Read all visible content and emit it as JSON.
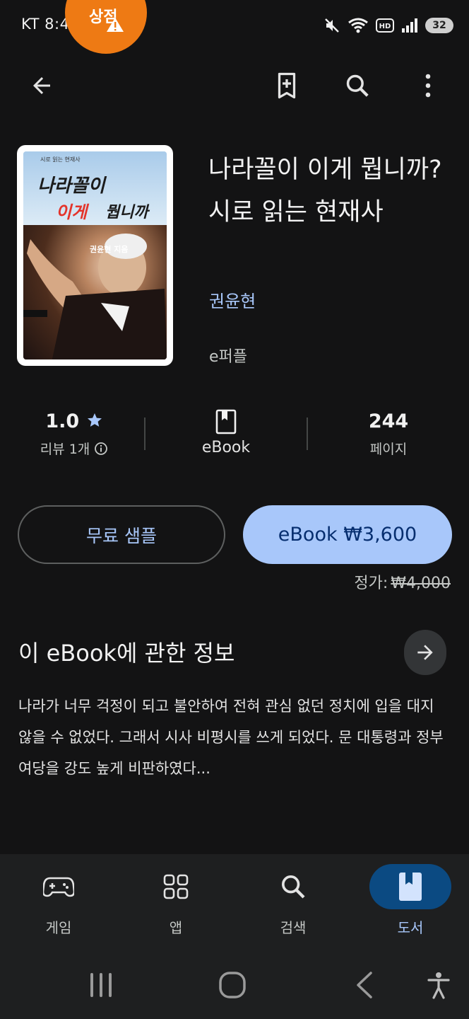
{
  "status_bar": {
    "carrier_time": "KT 8:48",
    "promo_badge": "상점",
    "battery": "32"
  },
  "book": {
    "title": "나라꼴이 이게 뭡니까? 시로 읽는 현재사",
    "author": "권윤현",
    "publisher": "e퍼플",
    "cover": {
      "series": "시로 읽는 현재사",
      "title_line1": "나라꼴이",
      "title_line2_red": "이게",
      "title_line2_black": "뭡니까",
      "author_text": "권윤현 지음"
    }
  },
  "stats": {
    "rating": "1.0",
    "reviews": "리뷰 1개",
    "format": "eBook",
    "pages": "244",
    "pages_label": "페이지"
  },
  "actions": {
    "sample": "무료 샘플",
    "buy": "eBook ₩3,600",
    "list_price_label": "정가:",
    "list_price": "₩4,000"
  },
  "about": {
    "title": "이 eBook에 관한 정보",
    "description": "나라가 너무 걱정이 되고 불안하여 전혀 관심 없던 정치에 입을 대지 않을 수 없었다. 그래서 시사 비평시를 쓰게 되었다. 문 대통령과 정부 여당을 강도 높게 비판하였다..."
  },
  "bottom_nav": {
    "items": [
      {
        "label": "게임",
        "icon": "gamepad-icon"
      },
      {
        "label": "앱",
        "icon": "apps-grid-icon"
      },
      {
        "label": "검색",
        "icon": "search-icon"
      },
      {
        "label": "도서",
        "icon": "book-icon",
        "active": true
      }
    ]
  },
  "colors": {
    "background": "#131314",
    "accent": "#a8c7fa",
    "accent_dark": "#0b4a82",
    "promo": "#ee7a14"
  }
}
